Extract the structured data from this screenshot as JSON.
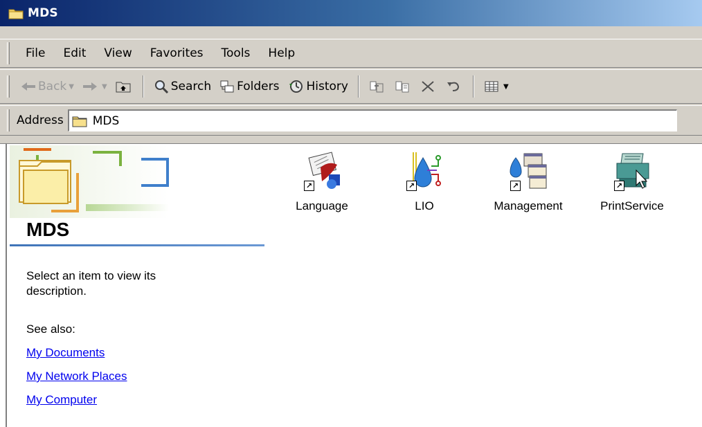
{
  "window": {
    "title": "MDS"
  },
  "menu": [
    "File",
    "Edit",
    "View",
    "Favorites",
    "Tools",
    "Help"
  ],
  "toolbar": {
    "back": "Back",
    "search": "Search",
    "folders": "Folders",
    "history": "History"
  },
  "address": {
    "label": "Address",
    "value": "MDS"
  },
  "panel": {
    "title": "MDS",
    "description": "Select an item to view its description.",
    "see_also": "See also:",
    "links": [
      "My Documents",
      "My Network Places",
      "My Computer"
    ]
  },
  "items": [
    {
      "name": "Language",
      "icon": "language-shortcut-icon"
    },
    {
      "name": "LIO",
      "icon": "lio-shortcut-icon"
    },
    {
      "name": "Management",
      "icon": "management-shortcut-icon"
    },
    {
      "name": "PrintService",
      "icon": "printservice-shortcut-icon"
    }
  ]
}
